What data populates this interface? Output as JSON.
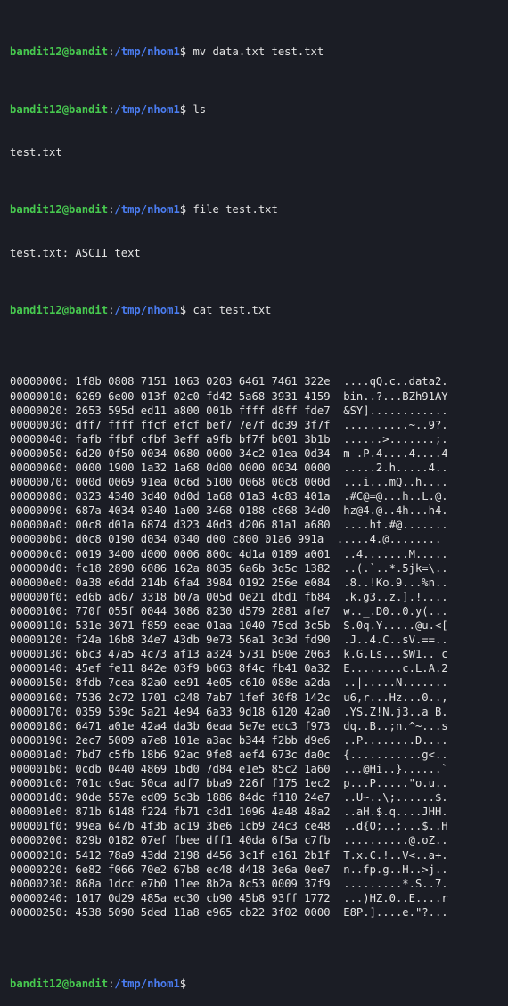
{
  "window": {
    "app": "terminal",
    "background": "#1b1d25",
    "accent_user": "#47c94f",
    "accent_path": "#4a7cf0"
  },
  "prompt": {
    "user_host": "bandit12@bandit",
    "separator": ":",
    "path": "/tmp/nhom1",
    "dollar": "$"
  },
  "session": [
    {
      "cmd": " mv data.txt test.txt"
    },
    {
      "cmd": " ls",
      "output": [
        "test.txt"
      ]
    },
    {
      "cmd": " file test.txt",
      "output": [
        "test.txt: ASCII text"
      ]
    },
    {
      "cmd": " cat test.txt"
    }
  ],
  "hexdump": [
    {
      "offset": "00000000:",
      "bytes": "1f8b 0808 7151 1063 0203 6461 7461 322e",
      "ascii": "....qQ.c..data2."
    },
    {
      "offset": "00000010:",
      "bytes": "6269 6e00 013f 02c0 fd42 5a68 3931 4159",
      "ascii": "bin..?...BZh91AY"
    },
    {
      "offset": "00000020:",
      "bytes": "2653 595d ed11 a800 001b ffff d8ff fde7",
      "ascii": "&SY]............"
    },
    {
      "offset": "00000030:",
      "bytes": "dff7 ffff ffcf efcf bef7 7e7f dd39 3f7f",
      "ascii": "..........~..9?."
    },
    {
      "offset": "00000040:",
      "bytes": "fafb ffbf cfbf 3eff a9fb bf7f b001 3b1b",
      "ascii": "......>.......;."
    },
    {
      "offset": "00000050:",
      "bytes": "6d20 0f50 0034 0680 0000 34c2 01ea 0d34",
      "ascii": "m .P.4....4....4"
    },
    {
      "offset": "00000060:",
      "bytes": "0000 1900 1a32 1a68 0d00 0000 0034 0000",
      "ascii": ".....2.h.....4.."
    },
    {
      "offset": "00000070:",
      "bytes": "000d 0069 91ea 0c6d 5100 0068 00c8 000d",
      "ascii": "...i...mQ..h...."
    },
    {
      "offset": "00000080:",
      "bytes": "0323 4340 3d40 0d0d 1a68 01a3 4c83 401a",
      "ascii": ".#C@=@...h..L.@."
    },
    {
      "offset": "00000090:",
      "bytes": "687a 4034 0340 1a00 3468 0188 c868 34d0",
      "ascii": "hz@4.@..4h...h4."
    },
    {
      "offset": "000000a0:",
      "bytes": "00c8 d01a 6874 d323 40d3 d206 81a1 a680",
      "ascii": "....ht.#@......."
    },
    {
      "offset": "000000b0:",
      "bytes": "d0c8 0190 d034 0340 d00 c800 01a6 991a",
      "ascii": ".....4.@........"
    },
    {
      "offset": "000000c0:",
      "bytes": "0019 3400 d000 0006 800c 4d1a 0189 a001",
      "ascii": "..4.......M....."
    },
    {
      "offset": "000000d0:",
      "bytes": "fc18 2890 6086 162a 8035 6a6b 3d5c 1382",
      "ascii": "..(.`..*.5jk=\\.."
    },
    {
      "offset": "000000e0:",
      "bytes": "0a38 e6dd 214b 6fa4 3984 0192 256e e084",
      "ascii": ".8..!Ko.9...%n.."
    },
    {
      "offset": "000000f0:",
      "bytes": "ed6b ad67 3318 b07a 005d 0e21 dbd1 fb84",
      "ascii": ".k.g3..z.].!...."
    },
    {
      "offset": "00000100:",
      "bytes": "770f 055f 0044 3086 8230 d579 2881 afe7",
      "ascii": "w.._.D0..0.y(..."
    },
    {
      "offset": "00000110:",
      "bytes": "531e 3071 f859 eeae 01aa 1040 75cd 3c5b",
      "ascii": "S.0q.Y.....@u.<["
    },
    {
      "offset": "00000120:",
      "bytes": "f24a 16b8 34e7 43db 9e73 56a1 3d3d fd90",
      "ascii": ".J..4.C..sV.==.."
    },
    {
      "offset": "00000130:",
      "bytes": "6bc3 47a5 4c73 af13 a324 5731 b90e 2063",
      "ascii": "k.G.Ls...$W1.. c"
    },
    {
      "offset": "00000140:",
      "bytes": "45ef fe11 842e 03f9 b063 8f4c fb41 0a32",
      "ascii": "E........c.L.A.2"
    },
    {
      "offset": "00000150:",
      "bytes": "8fdb 7cea 82a0 ee91 4e05 c610 088e a2da",
      "ascii": "..|.....N......."
    },
    {
      "offset": "00000160:",
      "bytes": "7536 2c72 1701 c248 7ab7 1fef 30f8 142c",
      "ascii": "u6,r...Hz...0..,"
    },
    {
      "offset": "00000170:",
      "bytes": "0359 539c 5a21 4e94 6a33 9d18 6120 42a0",
      "ascii": ".YS.Z!N.j3..a B."
    },
    {
      "offset": "00000180:",
      "bytes": "6471 a01e 42a4 da3b 6eaa 5e7e edc3 f973",
      "ascii": "dq..B..;n.^~...s"
    },
    {
      "offset": "00000190:",
      "bytes": "2ec7 5009 a7e8 101e a3ac b344 f2bb d9e6",
      "ascii": "..P........D...."
    },
    {
      "offset": "000001a0:",
      "bytes": "7bd7 c5fb 18b6 92ac 9fe8 aef4 673c da0c",
      "ascii": "{...........g<.."
    },
    {
      "offset": "000001b0:",
      "bytes": "0cdb 0440 4869 1bd0 7d84 e1e5 85c2 1a60",
      "ascii": "...@Hi..}......`"
    },
    {
      "offset": "000001c0:",
      "bytes": "701c c9ac 50ca adf7 bba9 226f f175 1ec2",
      "ascii": "p...P.....\"o.u.."
    },
    {
      "offset": "000001d0:",
      "bytes": "90de 557e ed09 5c3b 1886 84dc f110 24e7",
      "ascii": "..U~..\\;......$."
    },
    {
      "offset": "000001e0:",
      "bytes": "871b 6148 f224 fb71 c3d1 1096 4a48 48a2",
      "ascii": "..aH.$.q....JHH."
    },
    {
      "offset": "000001f0:",
      "bytes": "99ea 647b 4f3b ac19 3be6 1cb9 24c3 ce48",
      "ascii": "..d{O;..;...$..H"
    },
    {
      "offset": "00000200:",
      "bytes": "829b 0182 07ef fbee dff1 40da 6f5a c7fb",
      "ascii": "..........@.oZ.."
    },
    {
      "offset": "00000210:",
      "bytes": "5412 78a9 43dd 2198 d456 3c1f e161 2b1f",
      "ascii": "T.x.C.!..V<..a+."
    },
    {
      "offset": "00000220:",
      "bytes": "6e82 f066 70e2 67b8 ec48 d418 3e6a 0ee7",
      "ascii": "n..fp.g..H..>j.."
    },
    {
      "offset": "00000230:",
      "bytes": "868a 1dcc e7b0 11ee 8b2a 8c53 0009 37f9",
      "ascii": ".........*.S..7."
    },
    {
      "offset": "00000240:",
      "bytes": "1017 0d29 485a ec30 cb90 45b8 93ff 1772",
      "ascii": "...)HZ.0..E....r"
    },
    {
      "offset": "00000250:",
      "bytes": "4538 5090 5ded 11a8 e965 cb22 3f02 0000",
      "ascii": "E8P.]....e.\"?..."
    }
  ]
}
